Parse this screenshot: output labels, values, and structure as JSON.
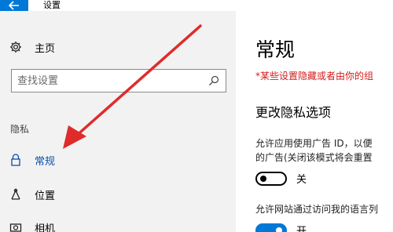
{
  "titlebar": {
    "title": "设置",
    "back_icon": "back-arrow-icon"
  },
  "sidebar": {
    "home_label": "主页",
    "search": {
      "placeholder": "查找设置"
    },
    "group_label": "隐私",
    "items": [
      {
        "label": "常规",
        "icon": "lock-icon",
        "active": true
      },
      {
        "label": "位置",
        "icon": "location-icon",
        "active": false
      },
      {
        "label": "相机",
        "icon": "camera-icon",
        "active": false
      }
    ]
  },
  "main": {
    "title": "常规",
    "warning": "*某些设置隐藏或者由你的组",
    "section_title": "更改隐私选项",
    "setting1": {
      "desc_line1": "允许应用使用广告 ID，以便",
      "desc_line2": "的广告(关闭该模式将会重置",
      "toggle_label": "关",
      "toggle_on": false
    },
    "setting2": {
      "desc": "允许网站通过访问我的语言列",
      "toggle_label": "开",
      "toggle_on": true
    }
  },
  "colors": {
    "accent": "#0078d7",
    "warning": "#d21b1b",
    "annotation_arrow": "#e02b2b"
  }
}
